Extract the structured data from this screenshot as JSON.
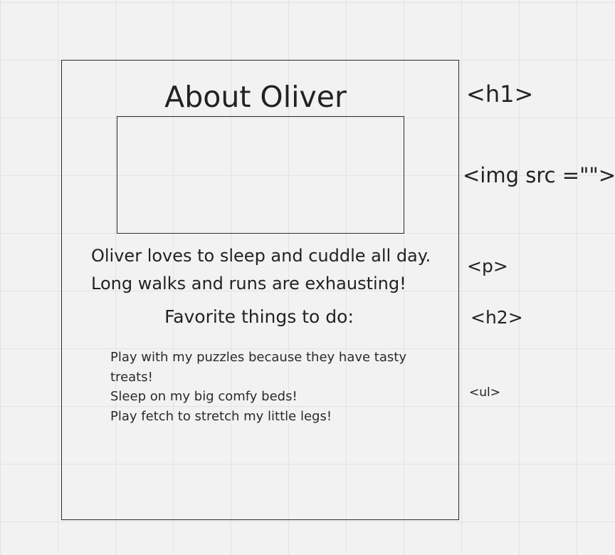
{
  "mockup": {
    "heading": "About Oliver",
    "image_placeholder": "",
    "paragraph_lines": [
      "Oliver loves to sleep and cuddle all day.",
      "Long walks and runs are exhausting!"
    ],
    "subheading": "Favorite things to do:",
    "list_items": [
      "Play with my puzzles because they have tasty treats!",
      "Sleep on my big comfy beds!",
      "Play fetch to stretch my little legs!"
    ]
  },
  "annotations": {
    "h1": "<h1>",
    "img": "<img src =\"\">",
    "p": "<p>",
    "h2": "<h2>",
    "ul": "<ul>"
  },
  "colors": {
    "background": "#f2f2f2",
    "grid_line": "#e3e3e3",
    "frame_stroke": "#2b2b2b",
    "text": "#222222"
  }
}
